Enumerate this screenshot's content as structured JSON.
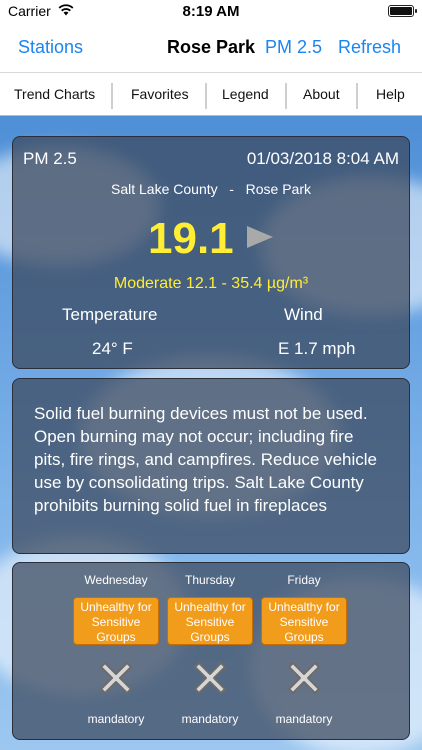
{
  "status_bar": {
    "carrier": "Carrier",
    "time": "8:19 AM"
  },
  "nav": {
    "back": "Stations",
    "title": "Rose Park",
    "pollutant": "PM 2.5",
    "refresh": "Refresh"
  },
  "tabs": [
    "Trend Charts",
    "Favorites",
    "Legend",
    "About",
    "Help"
  ],
  "reading": {
    "pollutant": "PM 2.5",
    "datetime": "01/03/2018 8:04 AM",
    "location": "Salt Lake County   -   Rose Park",
    "value": "19.1",
    "category": "Moderate 12.1 - 35.4 µg/m³",
    "temperature_label": "Temperature",
    "wind_label": "Wind",
    "temperature": "24° F",
    "wind": "E 1.7 mph"
  },
  "advisory": "Solid fuel burning devices must not be used. Open burning may not occur; including fire pits, fire rings, and campfires. Reduce vehicle use by consolidating trips. Salt Lake County prohibits burning solid fuel in fireplaces",
  "forecast": [
    {
      "day": "Wednesday",
      "level": "Unhealthy for Sensitive Groups",
      "action": "mandatory"
    },
    {
      "day": "Thursday",
      "level": "Unhealthy for Sensitive Groups",
      "action": "mandatory"
    },
    {
      "day": "Friday",
      "level": "Unhealthy for Sensitive Groups",
      "action": "mandatory"
    }
  ],
  "colors": {
    "accent": "#1a84f2",
    "value": "#ffee33",
    "badge": "#f29c1c"
  },
  "icons": {
    "trend": "right-arrow-icon",
    "burn": "no-burn-x-icon"
  }
}
